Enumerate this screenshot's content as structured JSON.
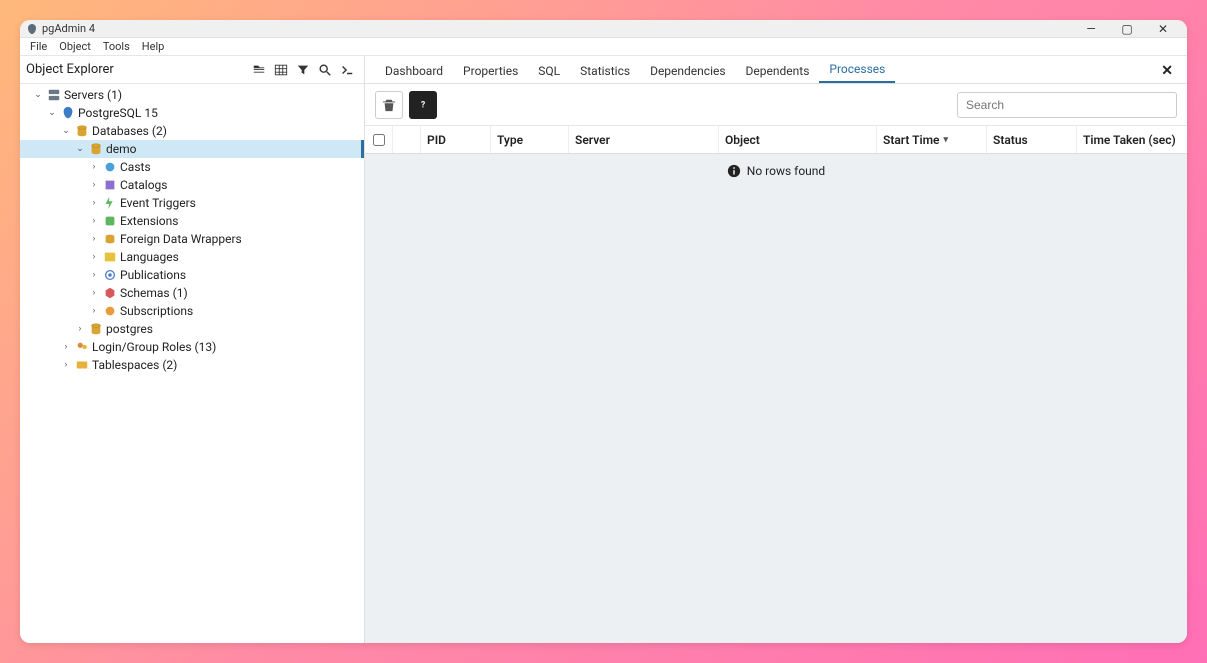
{
  "window": {
    "app_title": "pgAdmin 4"
  },
  "menubar": [
    "File",
    "Object",
    "Tools",
    "Help"
  ],
  "object_explorer": {
    "title": "Object Explorer"
  },
  "tree": [
    {
      "depth": 0,
      "toggle": "down",
      "icon": "servers",
      "label": "Servers (1)"
    },
    {
      "depth": 1,
      "toggle": "down",
      "icon": "pg",
      "label": "PostgreSQL 15"
    },
    {
      "depth": 2,
      "toggle": "down",
      "icon": "db-group",
      "label": "Databases (2)"
    },
    {
      "depth": 3,
      "toggle": "down",
      "icon": "db",
      "label": "demo",
      "selected": true
    },
    {
      "depth": 4,
      "toggle": "right",
      "icon": "casts",
      "label": "Casts"
    },
    {
      "depth": 4,
      "toggle": "right",
      "icon": "catalogs",
      "label": "Catalogs"
    },
    {
      "depth": 4,
      "toggle": "right",
      "icon": "event-trig",
      "label": "Event Triggers"
    },
    {
      "depth": 4,
      "toggle": "right",
      "icon": "extensions",
      "label": "Extensions"
    },
    {
      "depth": 4,
      "toggle": "right",
      "icon": "fdw",
      "label": "Foreign Data Wrappers"
    },
    {
      "depth": 4,
      "toggle": "right",
      "icon": "languages",
      "label": "Languages"
    },
    {
      "depth": 4,
      "toggle": "right",
      "icon": "publications",
      "label": "Publications"
    },
    {
      "depth": 4,
      "toggle": "right",
      "icon": "schemas",
      "label": "Schemas (1)"
    },
    {
      "depth": 4,
      "toggle": "right",
      "icon": "subscriptions",
      "label": "Subscriptions"
    },
    {
      "depth": 3,
      "toggle": "right",
      "icon": "db",
      "label": "postgres"
    },
    {
      "depth": 2,
      "toggle": "right",
      "icon": "roles",
      "label": "Login/Group Roles (13)"
    },
    {
      "depth": 2,
      "toggle": "right",
      "icon": "tablespaces",
      "label": "Tablespaces (2)"
    }
  ],
  "tabs": [
    "Dashboard",
    "Properties",
    "SQL",
    "Statistics",
    "Dependencies",
    "Dependents",
    "Processes"
  ],
  "active_tab": "Processes",
  "search": {
    "placeholder": "Search"
  },
  "columns": {
    "pid": "PID",
    "type": "Type",
    "server": "Server",
    "object": "Object",
    "start": "Start Time",
    "status": "Status",
    "time": "Time Taken (sec)"
  },
  "empty_message": "No rows found",
  "colors": {
    "accent": "#2b6ea3",
    "db_gold": "#d9a432",
    "pg_blue": "#3b7dc4"
  }
}
